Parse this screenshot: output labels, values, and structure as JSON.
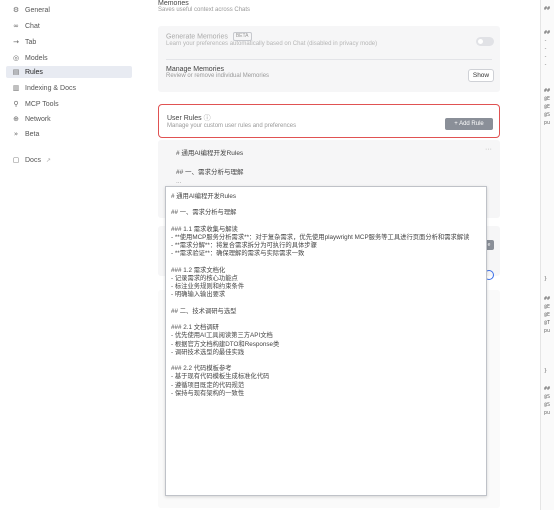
{
  "sidebar": {
    "items": [
      {
        "icon": "⚙",
        "label": "General"
      },
      {
        "icon": "∞",
        "label": "Chat"
      },
      {
        "icon": "→",
        "label": "Tab"
      },
      {
        "icon": "◎",
        "label": "Models"
      },
      {
        "icon": "▤",
        "label": "Rules"
      },
      {
        "icon": "▥",
        "label": "Indexing & Docs"
      },
      {
        "icon": "⚲",
        "label": "MCP Tools"
      },
      {
        "icon": "⊕",
        "label": "Network"
      },
      {
        "icon": "»",
        "label": "Beta"
      }
    ],
    "docs_label": "Docs",
    "docs_icon": "▢",
    "docs_external": "↗"
  },
  "memories": {
    "title": "Memories",
    "desc": "Saves useful context across Chats",
    "generate_title": "Generate Memories",
    "generate_badge": "BETA",
    "generate_desc": "Learn your preferences automatically based on Chat (disabled in privacy mode)",
    "manage_title": "Manage Memories",
    "manage_desc": "Review or remove individual Memories",
    "show_label": "Show"
  },
  "user_rules": {
    "title": "User Rules",
    "desc": "Manage your custom user rules and preferences",
    "add_label": "+ Add Rule",
    "preview_lines": [
      "# 通用AI编程开发Rules",
      "## 一、需求分析与理解",
      "..."
    ],
    "menu": "···"
  },
  "popover": {
    "lines": [
      "# 通用AI编程开发Rules",
      "",
      "## 一、需求分析与理解",
      "",
      "### 1.1 需求收集与解读",
      "- **使用MCP服务分析需求**：对于复杂需求，优先使用playwright MCP服务等工具进行页面分析和需求解读",
      "- **需求分解**：将复合需求拆分为可执行的具体步骤",
      "- **需求验证**：确保理解的需求与实际需求一致",
      "",
      "### 1.2 需求文档化",
      "- 记录需求的核心功能点",
      "- 标注业务规则和约束条件",
      "- 明确输入输出要求",
      "",
      "## 二、技术调研与选型",
      "",
      "### 2.1 文档调研",
      "- 优先使用AI工具阅读第三方API文档",
      "- 根据官方文档构建DTO和Response类",
      "- 调研技术选型的最佳实践",
      "",
      "### 2.2 代码模板参考",
      "- 基于现有代码模板生成标准化代码",
      "- 遵循项目既定的代码规范",
      "- 保持与现有架构的一致性"
    ]
  },
  "right_panel": {
    "lines": [
      "##",
      "##",
      "-",
      "-",
      "-",
      "-",
      "##",
      "@E",
      "@E",
      "@S",
      "pu",
      "}",
      "##",
      "@E",
      "@E",
      "@T",
      "pu",
      "}",
      "##",
      "@S",
      "@S",
      "pu"
    ]
  }
}
